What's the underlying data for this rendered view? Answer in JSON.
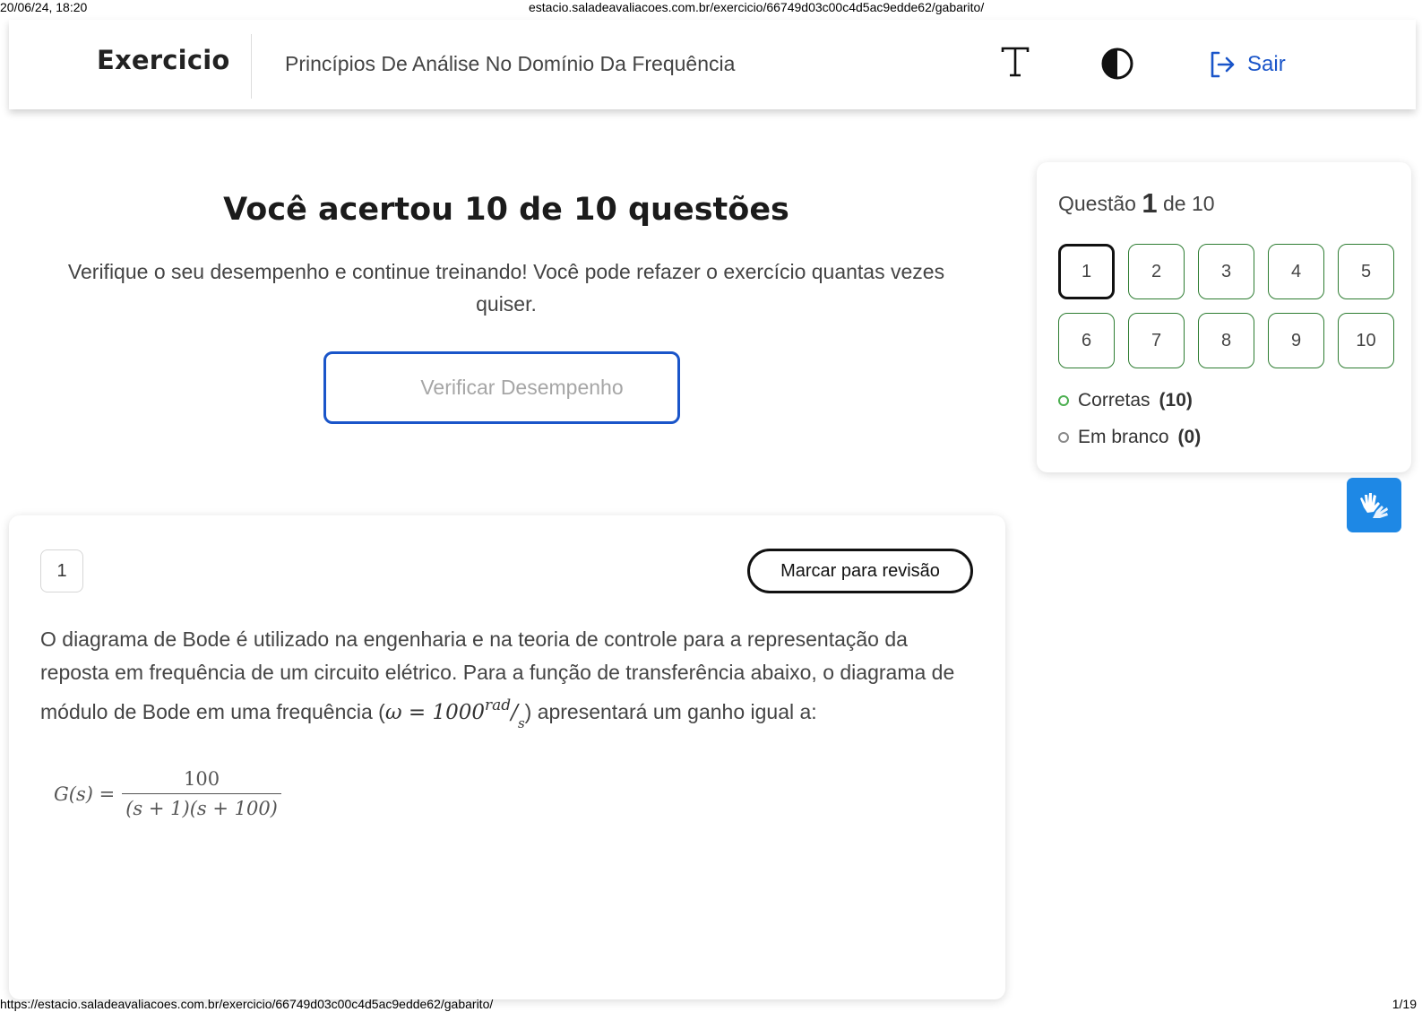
{
  "print_header": {
    "datetime": "20/06/24, 18:20",
    "url": "estacio.saladeavaliacoes.com.br/exercicio/66749d03c00c4d5ac9edde62/gabarito/"
  },
  "print_footer": {
    "url": "https://estacio.saladeavaliacoes.com.br/exercicio/66749d03c00c4d5ac9edde62/gabarito/",
    "page": "1/19"
  },
  "topbar": {
    "brand": "Exercicio",
    "subject": "Princípios De Análise No Domínio Da Frequência",
    "font_icon": "font-size-icon",
    "contrast_icon": "contrast-icon",
    "logout_icon": "logout-icon",
    "logout_label": "Sair",
    "accent_color": "#1a55c9"
  },
  "result": {
    "title": "Você acertou 10 de 10 questões",
    "subtitle": "Verifique o seu desempenho e continue treinando! Você pode refazer o exercício quantas vezes quiser.",
    "verify_label": "Verificar Desempenho"
  },
  "navigator": {
    "label_prefix": "Questão",
    "current": "1",
    "label_suffix": "de 10",
    "questions": [
      "1",
      "2",
      "3",
      "4",
      "5",
      "6",
      "7",
      "8",
      "9",
      "10"
    ],
    "legend": [
      {
        "label": "Corretas",
        "count": "(10)",
        "color": "#4caf50"
      },
      {
        "label": "Em branco",
        "count": "(0)",
        "color": "#888888"
      }
    ]
  },
  "accessibility": {
    "libras_icon": "sign-language-icon"
  },
  "question": {
    "number": "1",
    "review_label": "Marcar para revisão",
    "statement_part1": "O diagrama de Bode é utilizado na engenharia e na teoria de controle para a representação da reposta em frequência de um circuito elétrico. Para a função de transferência abaixo, o diagrama de módulo de Bode em uma frequência (",
    "omega_expr": "ω = 1000",
    "omega_unit_num": "rad",
    "omega_unit_den": "s",
    "statement_part2": ") apresentará um ganho igual a:",
    "formula_lhs": "G(s) =",
    "formula_numerator": "100",
    "formula_denominator": "(s + 1)(s + 100)"
  }
}
